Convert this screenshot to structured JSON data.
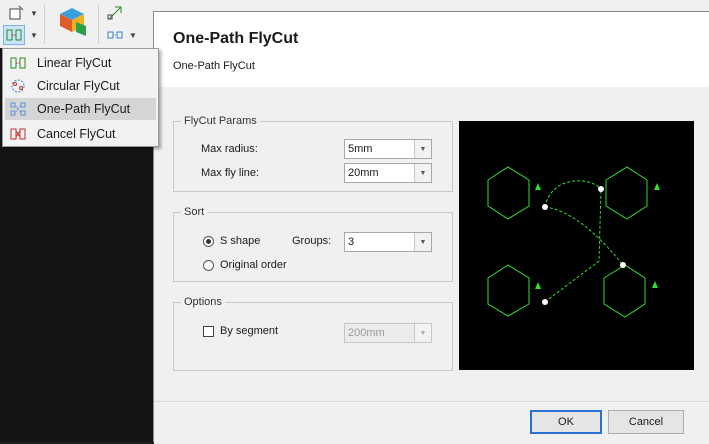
{
  "menu": {
    "items": [
      {
        "label": "Linear FlyCut",
        "icon": "linear-flycut-icon"
      },
      {
        "label": "Circular FlyCut",
        "icon": "circular-flycut-icon"
      },
      {
        "label": "One-Path FlyCut",
        "icon": "one-path-flycut-icon",
        "selected": true
      },
      {
        "label": "Cancel FlyCut",
        "icon": "cancel-flycut-icon"
      }
    ]
  },
  "dialog": {
    "title": "One-Path FlyCut",
    "subtitle": "One-Path FlyCut",
    "flycut_params": {
      "legend": "FlyCut Params",
      "max_radius_label": "Max radius:",
      "max_radius_value": "5mm",
      "max_fly_line_label": "Max fly line:",
      "max_fly_line_value": "20mm"
    },
    "sort": {
      "legend": "Sort",
      "s_shape_label": "S shape",
      "s_shape_checked": true,
      "groups_label": "Groups:",
      "groups_value": "3",
      "original_order_label": "Original order",
      "original_order_checked": false
    },
    "options": {
      "legend": "Options",
      "by_segment_label": "By segment",
      "by_segment_checked": false,
      "segment_value": "200mm"
    },
    "ok_label": "OK",
    "cancel_label": "Cancel"
  },
  "colors": {
    "preview_background": "#000000",
    "preview_shapes": "#2ee02e",
    "accent": "#2a6fd6"
  }
}
